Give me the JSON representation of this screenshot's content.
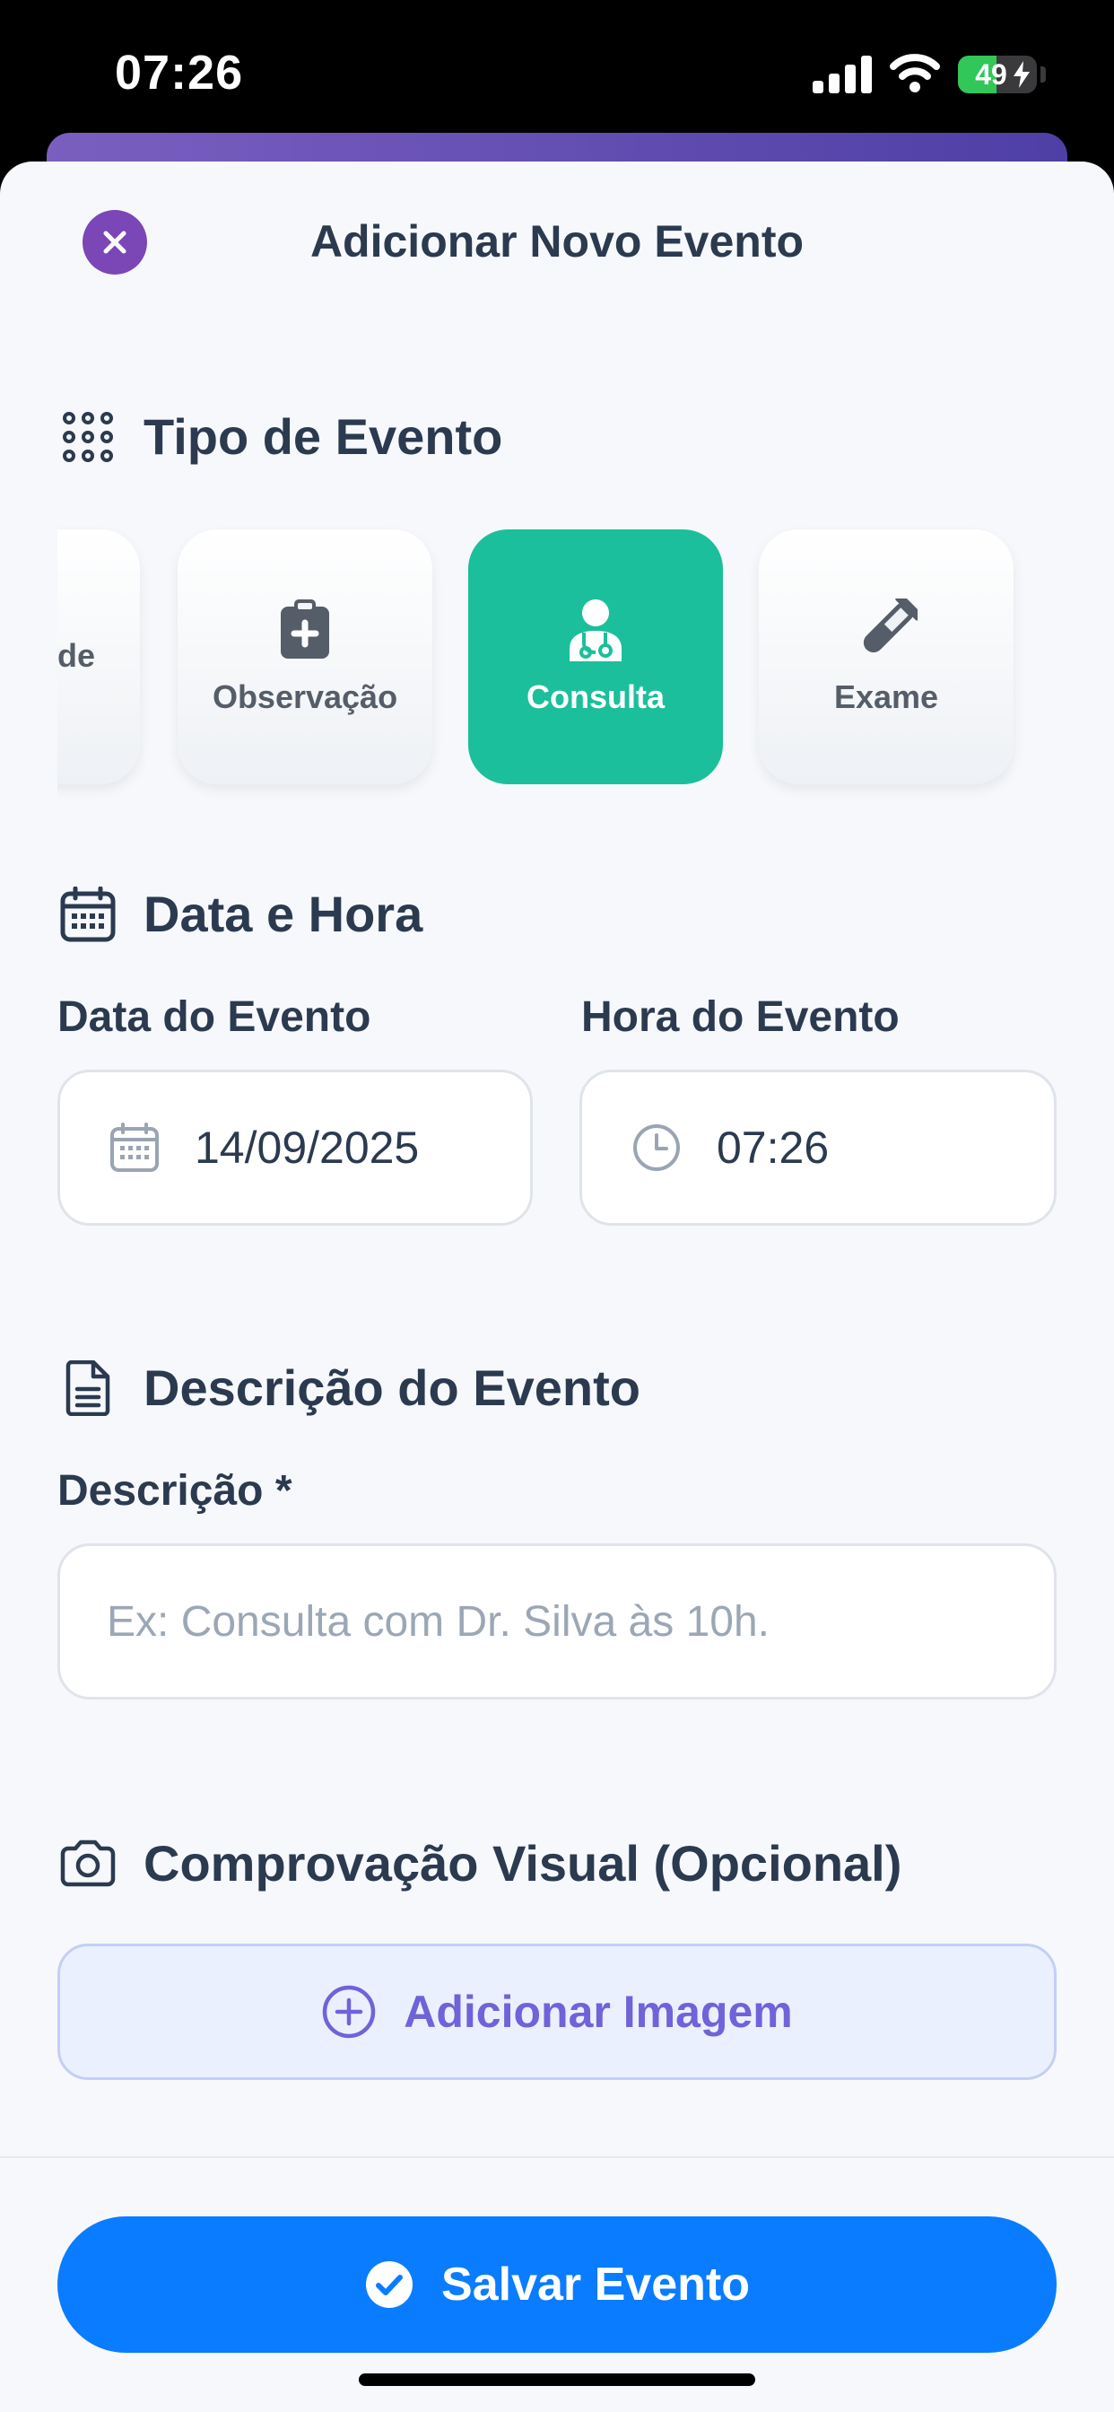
{
  "status_bar": {
    "time": "07:26",
    "battery_level": "49",
    "battery_fraction": 0.49,
    "charging": true
  },
  "sheet": {
    "title": "Adicionar Novo Evento"
  },
  "event_type": {
    "section_title": "Tipo de Evento",
    "partial_label": "de",
    "options": [
      {
        "label": "Observação",
        "icon": "clipboard-plus-icon",
        "selected": false
      },
      {
        "label": "Consulta",
        "icon": "doctor-icon",
        "selected": true
      },
      {
        "label": "Exame",
        "icon": "test-tube-icon",
        "selected": false
      }
    ]
  },
  "datetime": {
    "section_title": "Data e Hora",
    "date_label": "Data do Evento",
    "date_value": "14/09/2025",
    "time_label": "Hora do Evento",
    "time_value": "07:26"
  },
  "description": {
    "section_title": "Descrição do Evento",
    "field_label": "Descrição *",
    "placeholder": "Ex: Consulta com Dr. Silva às 10h."
  },
  "visual_proof": {
    "section_title": "Comprovação Visual (Opcional)",
    "add_label": "Adicionar Imagem"
  },
  "footer": {
    "save_label": "Salvar Evento"
  },
  "colors": {
    "accent_purple": "#7b46b5",
    "selected_teal": "#1cbf9b",
    "primary_blue": "#0a7cff",
    "add_image_text": "#6e63d9"
  }
}
